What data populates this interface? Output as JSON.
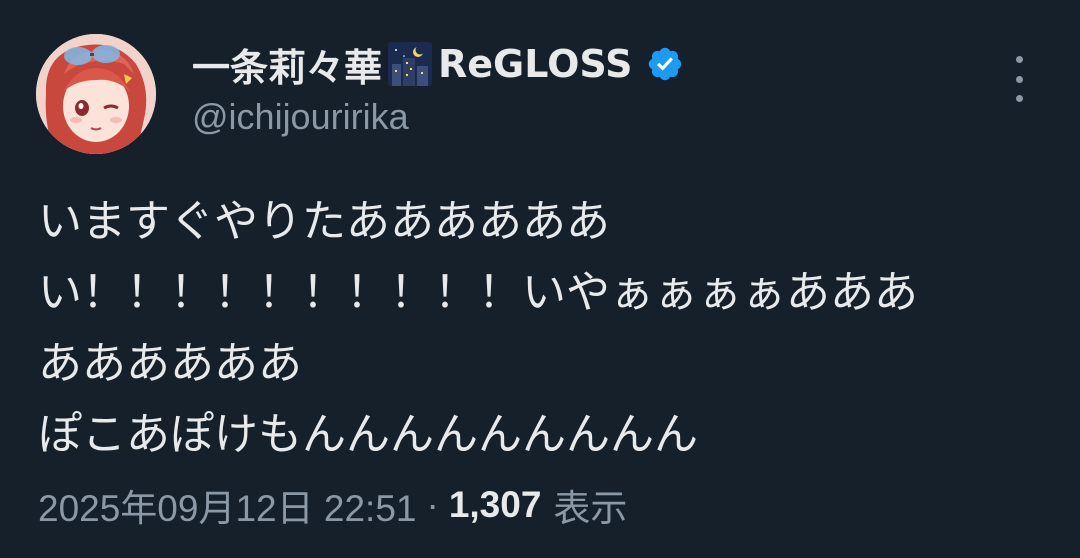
{
  "tweet": {
    "author": {
      "display_name": "一条莉々華",
      "name_suffix": "ReGLOSS",
      "handle": "@ichijouririka",
      "verified": true,
      "verified_color": "#1d9bf0"
    },
    "text_lines": [
      "いますぐやりたああああああ",
      "い！！！！！！！！！！いやぁぁぁぁあああ",
      "ああああああ",
      "ぽこあぽけもんんんんんんんんん"
    ],
    "timestamp": "2025年09月12日 22:51",
    "separator": "·",
    "views_count": "1,307",
    "views_label": "表示"
  },
  "icons": {
    "more": "more-vertical-icon",
    "verified": "verified-badge-icon",
    "name_emoji": "night-city-emoji"
  },
  "colors": {
    "background": "#15202b",
    "primary_text": "#e7e9ea",
    "secondary_text": "#8b98a5"
  }
}
